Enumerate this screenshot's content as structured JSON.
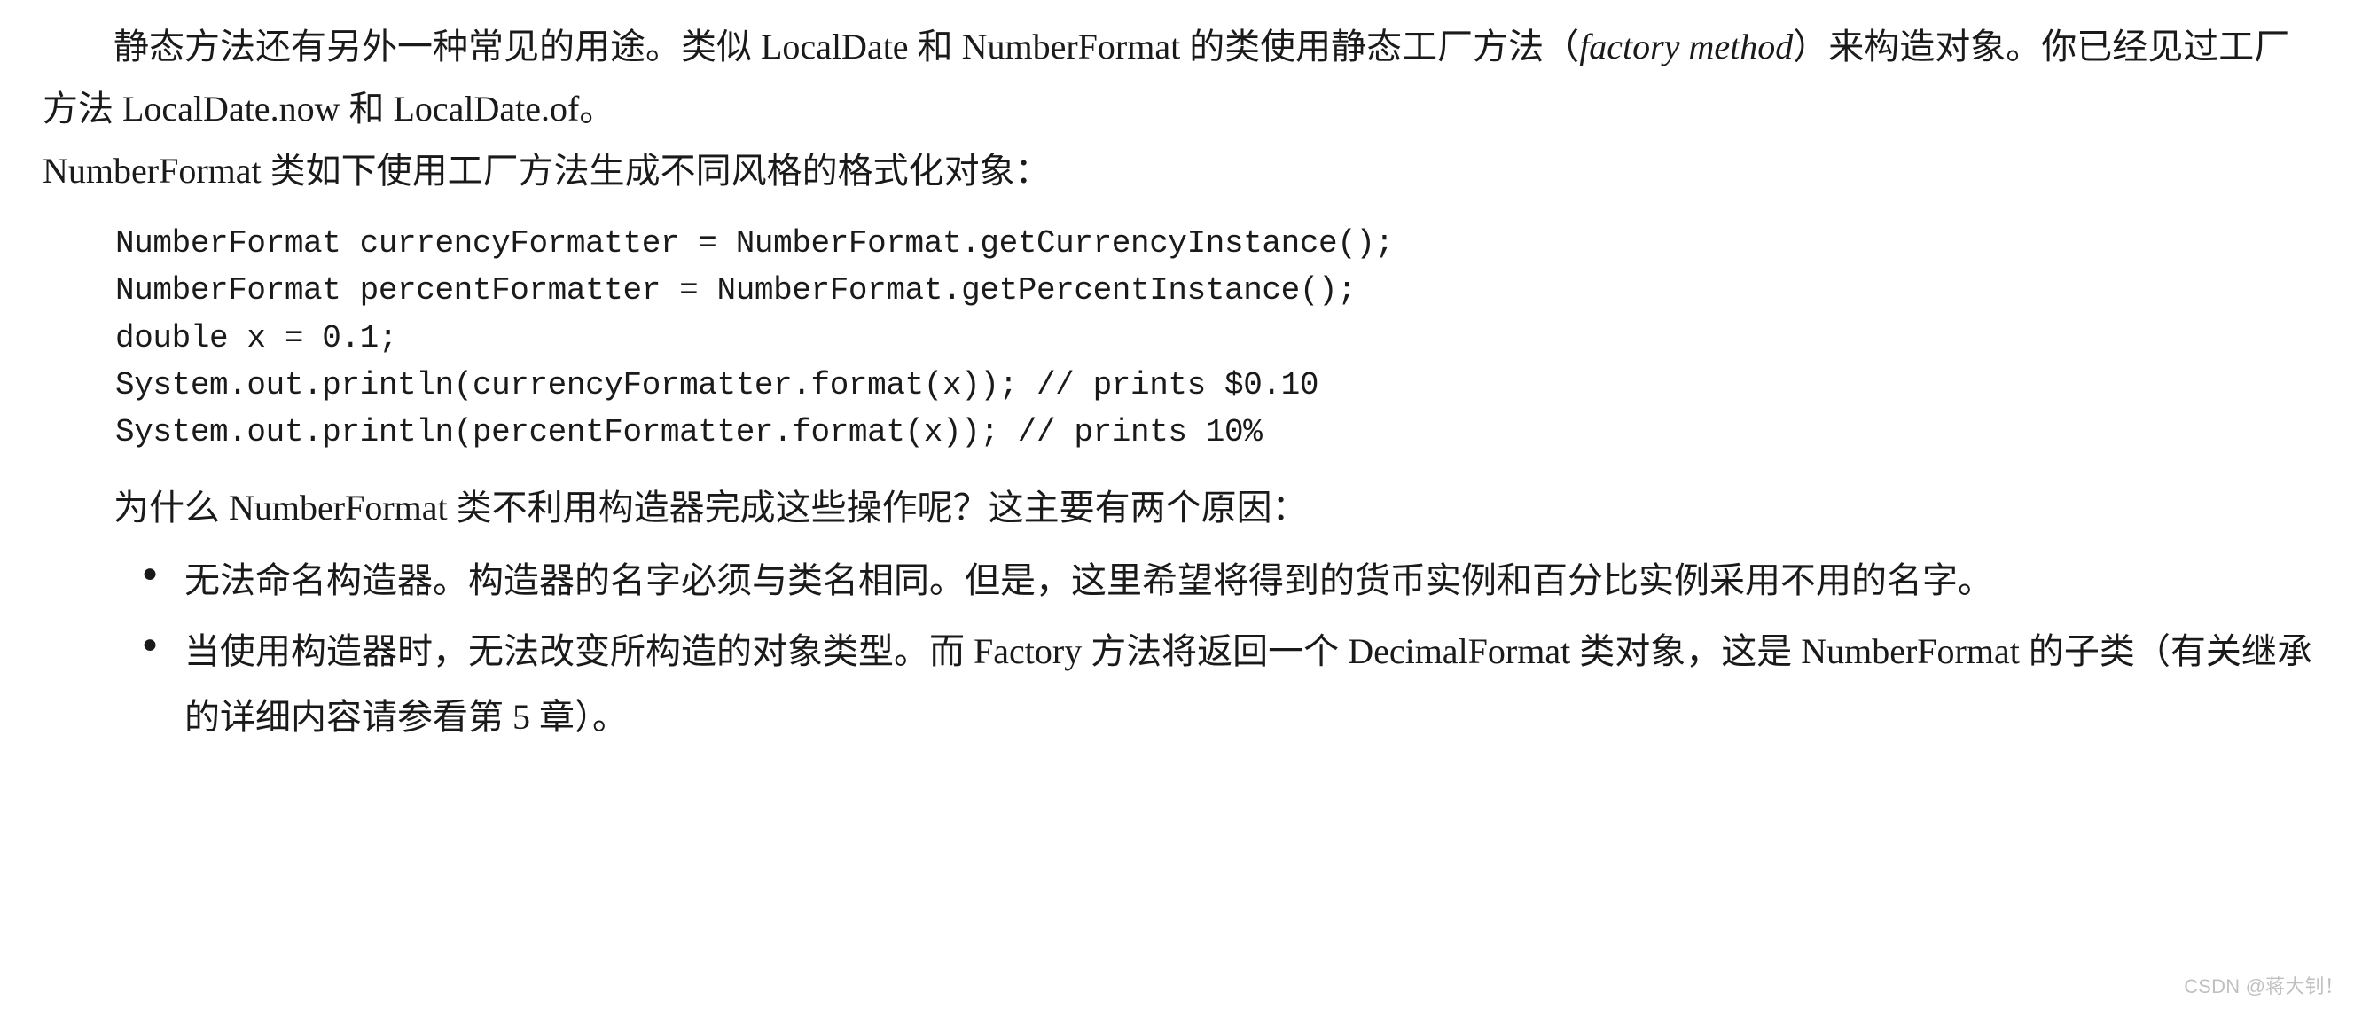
{
  "intro": {
    "seg1": "静态方法还有另外一种常见的用途。类似 ",
    "seg2": "LocalDate",
    "seg3": " 和 ",
    "seg4": "NumberFormat",
    "seg5": " 的类使用静态工厂方法（",
    "seg6": "factory method",
    "seg7": "）来构造对象。你已经见过工厂方法 ",
    "seg8": "LocalDate.now",
    "seg9": " 和 ",
    "seg10": "LocalDate.of",
    "seg11": "。",
    "seg12": "NumberFormat",
    "seg13": " 类如下使用工厂方法生成不同风格的格式化对象："
  },
  "code": {
    "l1": "NumberFormat currencyFormatter = NumberFormat.getCurrencyInstance();",
    "l2": "NumberFormat percentFormatter = NumberFormat.getPercentInstance();",
    "l3": "double x = 0.1;",
    "l4": "System.out.println(currencyFormatter.format(x)); // prints $0.10",
    "l5": "System.out.println(percentFormatter.format(x)); // prints 10%"
  },
  "question": {
    "seg1": "为什么 ",
    "seg2": "NumberFormat",
    "seg3": " 类不利用构造器完成这些操作呢？这主要有两个原因："
  },
  "bullets": {
    "b1": "无法命名构造器。构造器的名字必须与类名相同。但是，这里希望将得到的货币实例和百分比实例采用不用的名字。",
    "b2": {
      "seg1": "当使用构造器时，无法改变所构造的对象类型。而 ",
      "seg2": "Factory",
      "seg3": " 方法将返回一个 ",
      "seg4": "DecimalFormat",
      "seg5": " 类对象，这是 ",
      "seg6": "NumberFormat",
      "seg7": " 的子类（有关继承的详细内容请参看第 5 章）。"
    }
  },
  "watermark": "CSDN @蒋大钊！"
}
